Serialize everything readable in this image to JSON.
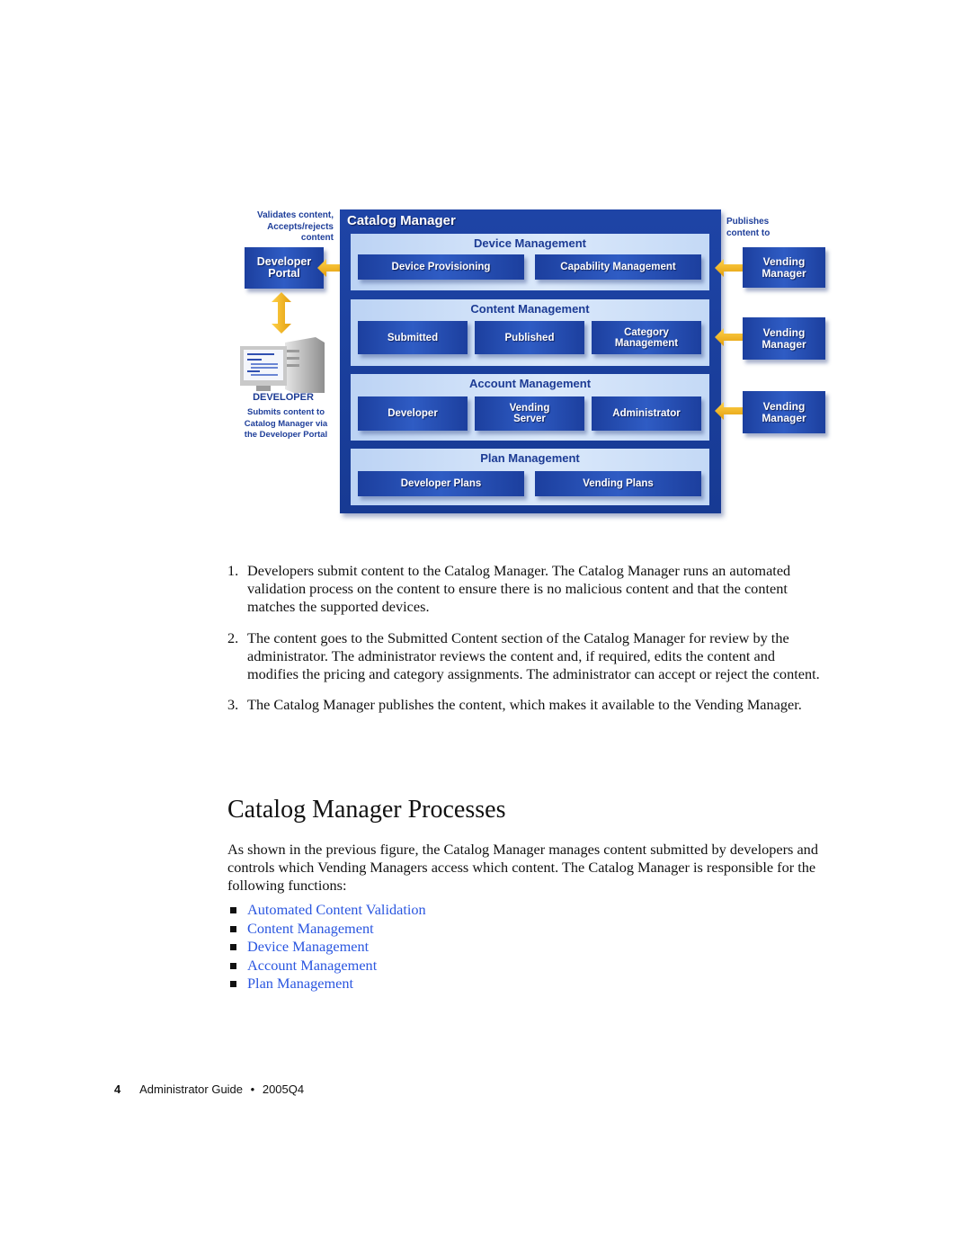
{
  "diagram": {
    "label_validates": [
      "Validates content,",
      "Accepts/rejects",
      "content"
    ],
    "developer_portal": [
      "Developer",
      "Portal"
    ],
    "developer_caption": "DEVELOPER",
    "developer_desc": [
      "Submits content to",
      "Catalog Manager via",
      "the Developer Portal"
    ],
    "catalog_manager_title": "Catalog Manager",
    "label_publishes": [
      "Publishes",
      "content to"
    ],
    "sections": [
      {
        "title": "Device Management",
        "modules": [
          "Device Provisioning",
          "Capability Management"
        ]
      },
      {
        "title": "Content Management",
        "modules": [
          "Submitted",
          "Published",
          "Category Management"
        ]
      },
      {
        "title": "Account Management",
        "modules": [
          "Developer",
          "Vending Server",
          "Administrator"
        ]
      },
      {
        "title": "Plan Management",
        "modules": [
          "Developer Plans",
          "Vending Plans"
        ]
      }
    ],
    "vending_managers": [
      "Vending Manager",
      "Vending Manager",
      "Vending Manager"
    ],
    "colors": {
      "box_blue": "#1c3f9e",
      "panel_light": "#dbe9fb",
      "arrow_gold": "#f0b418",
      "label_blue": "#1f3f9a"
    }
  },
  "steps": [
    {
      "num": "1.",
      "text": "Developers submit content to the Catalog Manager. The Catalog Manager runs an automated validation process on the content to ensure there is no malicious content and that the content matches the supported devices."
    },
    {
      "num": "2.",
      "text": "The content goes to the Submitted Content section of the Catalog Manager for review by the administrator. The administrator reviews the content and, if required, edits the content and modifies the pricing and category assignments. The administrator can accept or reject the content."
    },
    {
      "num": "3.",
      "text": "The Catalog Manager publishes the content, which makes it available to the Vending Manager."
    }
  ],
  "heading": "Catalog Manager Processes",
  "intro": "As shown in the previous figure, the Catalog Manager manages content submitted by developers and controls which Vending Managers access which content. The Catalog Manager is responsible for the following functions:",
  "links": [
    "Automated Content Validation",
    "Content Management",
    "Device Management",
    "Account Management",
    "Plan Management"
  ],
  "link_color": "#2a56e0",
  "footer": {
    "page": "4",
    "title": "Administrator Guide",
    "separator": "•",
    "version": "2005Q4"
  }
}
